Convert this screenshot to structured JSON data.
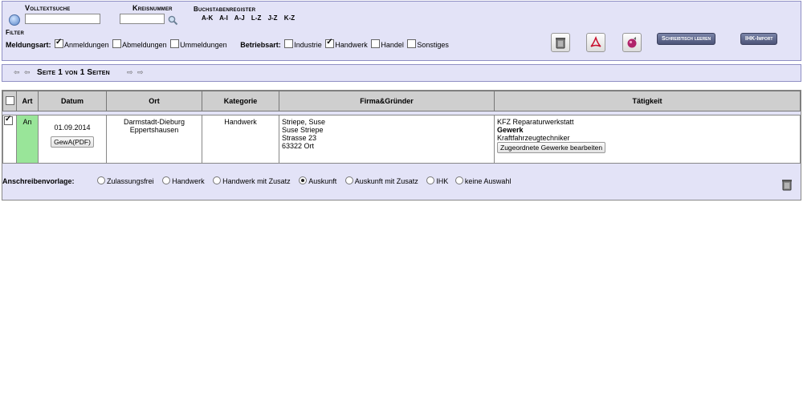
{
  "search": {
    "volltext_label": "Volltextsuche",
    "volltext_value": "",
    "kreis_label": "Kreisnummer",
    "kreis_value": "",
    "register_label": "Buchstabenregister",
    "register_links": [
      "A-K",
      "A-I",
      "A-J",
      "L-Z",
      "J-Z",
      "K-Z"
    ]
  },
  "filter": {
    "label": "Filter",
    "meldungsart_label": "Meldungsart:",
    "meldungsart": [
      {
        "label": "Anmeldungen",
        "checked": true
      },
      {
        "label": "Abmeldungen",
        "checked": false
      },
      {
        "label": "Ummeldungen",
        "checked": false
      }
    ],
    "betriebsart_label": "Betriebsart:",
    "betriebsart": [
      {
        "label": "Industrie",
        "checked": false
      },
      {
        "label": "Handwerk",
        "checked": true
      },
      {
        "label": "Handel",
        "checked": false
      },
      {
        "label": "Sonstiges",
        "checked": false
      }
    ]
  },
  "toolbar": {
    "icons": [
      "trash-icon",
      "pdf-icon",
      "ball-icon"
    ],
    "clear_label": "Schreibtisch leeren",
    "ihk_label": "IHK-Import"
  },
  "pager": {
    "label": "Seite 1 von 1 Seiten"
  },
  "table": {
    "headers": [
      "Art",
      "Datum",
      "Ort",
      "Kategorie",
      "Firma&Gründer",
      "Tätigkeit"
    ],
    "row": {
      "checked": true,
      "art": "An",
      "datum": "01.09.2014",
      "gewa_button": "GewA(PDF)",
      "ort_line1": "Darmstadt-Dieburg",
      "ort_line2": "Eppertshausen",
      "kategorie": "Handwerk",
      "firma": [
        "Striepe, Suse",
        "Suse Striepe",
        "Strasse 23",
        "63322 Ort"
      ],
      "taetigkeit_title": "KFZ Reparaturwerkstatt",
      "taetigkeit_gewerk": "Gewerk",
      "taetigkeit_detail": "Kraftfahrzeugtechniker",
      "edit_button": "Zugeordnete Gewerke bearbeiten"
    }
  },
  "vorlage": {
    "label": "Anschreibenvorlage:",
    "options": [
      {
        "label": "Zulassungsfrei",
        "selected": false
      },
      {
        "label": "Handwerk",
        "selected": false
      },
      {
        "label": "Handwerk mit Zusatz",
        "selected": false
      },
      {
        "label": "Auskunft",
        "selected": true
      },
      {
        "label": "Auskunft mit Zusatz",
        "selected": false
      },
      {
        "label": "IHK",
        "selected": false
      },
      {
        "label": "keine Auswahl",
        "selected": false
      }
    ]
  }
}
